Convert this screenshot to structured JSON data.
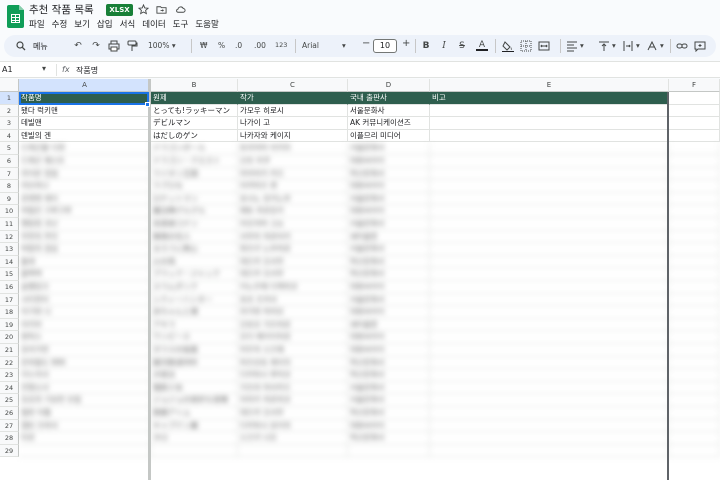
{
  "doc": {
    "title": "추천 작품 목록",
    "badge": "XLSX"
  },
  "title_icons": [
    "star-icon",
    "move-to-folder-icon",
    "cloud-status-icon"
  ],
  "menu": [
    "파일",
    "수정",
    "보기",
    "삽입",
    "서식",
    "데이터",
    "도구",
    "도움말"
  ],
  "toolbar": {
    "search": "메뉴",
    "zoom": "100%",
    "currency": "₩",
    "percent": "%",
    "dec_decrease": ".0",
    "dec_increase": ".00",
    "number_format": "123",
    "font": "Arial",
    "font_size": "10"
  },
  "formula_bar": {
    "cell_ref": "A1",
    "fx": "fx",
    "value": "작품명"
  },
  "columns": [
    "A",
    "B",
    "C",
    "D",
    "E",
    "F"
  ],
  "header_row": [
    "작품명",
    "원제",
    "작가",
    "국내 출판사",
    "비고"
  ],
  "rows": [
    [
      "됐다 럭키맨",
      "とっても!ラッキーマン",
      "가모우 히로시",
      "서울문화사"
    ],
    [
      "데빌맨",
      "デビルマン",
      "나가이 고",
      "AK 커뮤니케이션즈"
    ],
    [
      "덴빌의 겐",
      "はだしのゲン",
      "나카자와 케이지",
      "이플므리 미디어"
    ],
    [
      "드래곤볼 디엔",
      "ドラゴンボール",
      "토리야마 아키라",
      "서울문화사"
    ],
    [
      "드래곤 퀘스트",
      "ドラゴン・クエスト",
      "산조 리쿠",
      "대원씨아이"
    ],
    [
      "라이온 킹덤",
      "ライオン王国",
      "미야자키 카즈",
      "학산문화사"
    ],
    [
      "러브히나",
      "ラブひな",
      "아카마츠 켄",
      "대원씨아이"
    ],
    [
      "로켓맨 레이",
      "ロケットマン",
      "호시노 유키노부",
      "서울문화사"
    ],
    [
      "마법진 구루구루",
      "魔法陣グルグル",
      "에토 히로유키",
      "대원씨아이"
    ],
    [
      "명탐정 코난",
      "名探偵コナン",
      "아오야마 고쇼",
      "서울문화사"
    ],
    [
      "무한의 주인",
      "無限の住人",
      "사무라 히로아키",
      "세미콜론"
    ],
    [
      "바람의 검심",
      "るろうに剣心",
      "와츠키 노부히로",
      "서울문화사"
    ],
    [
      "불새",
      "火の鳥",
      "데즈카 오사무",
      "학산문화사"
    ],
    [
      "블랙잭",
      "ブラック・ジャック",
      "데즈카 오사무",
      "학산문화사"
    ],
    [
      "슬램덩크",
      "スラムダンク",
      "이노우에 다케히코",
      "대원씨아이"
    ],
    [
      "시티헌터",
      "シティーハンター",
      "호조 츠카사",
      "서울문화사"
    ],
    [
      "아기와 나",
      "赤ちゃんと僕",
      "라가와 마리모",
      "대원씨아이"
    ],
    [
      "아키라",
      "アキラ",
      "오토모 가츠히로",
      "세미콜론"
    ],
    [
      "원피스",
      "ワンピース",
      "오다 에이이치로",
      "대원씨아이"
    ],
    [
      "유리가면",
      "ガラスの仮面",
      "미우치 스즈에",
      "대원씨아이"
    ],
    [
      "은하철도 999",
      "銀河鉄道999",
      "마츠모토 레이지",
      "학산문화사"
    ],
    [
      "이누야샤",
      "犬夜叉",
      "다카하시 루미코",
      "학산문화사"
    ],
    [
      "전영소녀",
      "電影少女",
      "가츠라 마사카즈",
      "서울문화사"
    ],
    [
      "죠죠의 기묘한 모험",
      "ジョジョの奇妙な冒険",
      "아라키 히로히코",
      "서울문화사"
    ],
    [
      "철완 아톰",
      "鉄腕アトム",
      "데즈카 오사무",
      "학산문화사"
    ],
    [
      "캡틴 츠바사",
      "キャプテン翼",
      "다카하시 요이치",
      "대원씨아이"
    ],
    [
      "타로",
      "タロ",
      "스즈키 나오",
      "학산문화사"
    ]
  ],
  "colors": {
    "header_bg": "#2e5e4e",
    "header_text": "#ffffff",
    "selection": "#1a73e8",
    "brand": "#0f9d58",
    "badge": "#188038"
  }
}
